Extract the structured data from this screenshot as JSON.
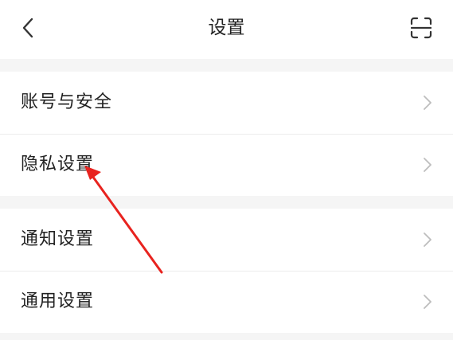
{
  "header": {
    "title": "设置",
    "back_icon": "chevron-left-icon",
    "scan_icon": "scan-icon"
  },
  "groups": [
    {
      "items": [
        {
          "label": "账号与安全",
          "icon": "chevron-right-icon"
        },
        {
          "label": "隐私设置",
          "icon": "chevron-right-icon"
        }
      ]
    },
    {
      "items": [
        {
          "label": "通知设置",
          "icon": "chevron-right-icon"
        },
        {
          "label": "通用设置",
          "icon": "chevron-right-icon"
        }
      ]
    }
  ],
  "colors": {
    "annotation_arrow": "#e8231f",
    "background": "#f5f5f5",
    "card": "#ffffff",
    "chevron": "#bdbdbd"
  }
}
